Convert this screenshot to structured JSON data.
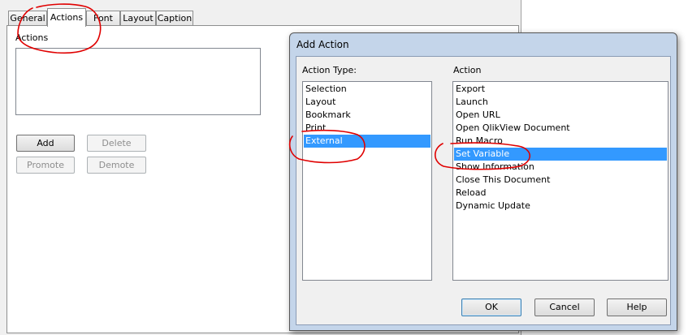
{
  "tabs": [
    {
      "label": "General"
    },
    {
      "label": "Actions"
    },
    {
      "label": "Font"
    },
    {
      "label": "Layout"
    },
    {
      "label": "Caption"
    }
  ],
  "actions_panel": {
    "label": "Actions",
    "buttons": {
      "add": "Add",
      "delete": "Delete",
      "promote": "Promote",
      "demote": "Demote"
    }
  },
  "dialog": {
    "title": "Add Action",
    "action_type_label": "Action Type:",
    "action_label": "Action",
    "action_types": [
      {
        "label": "Selection"
      },
      {
        "label": "Layout"
      },
      {
        "label": "Bookmark"
      },
      {
        "label": "Print"
      },
      {
        "label": "External"
      }
    ],
    "selected_action_type": "External",
    "actions": [
      {
        "label": "Export"
      },
      {
        "label": "Launch"
      },
      {
        "label": "Open URL"
      },
      {
        "label": "Open QlikView Document"
      },
      {
        "label": "Run Macro"
      },
      {
        "label": "Set Variable"
      },
      {
        "label": "Show Information"
      },
      {
        "label": "Close This Document"
      },
      {
        "label": "Reload"
      },
      {
        "label": "Dynamic Update"
      }
    ],
    "selected_action": "Set Variable",
    "buttons": {
      "ok": "OK",
      "cancel": "Cancel",
      "help": "Help"
    }
  },
  "colors": {
    "selection": "#3399ff",
    "annotation": "#e00000",
    "dialog_frame": "#c4d5ea"
  }
}
